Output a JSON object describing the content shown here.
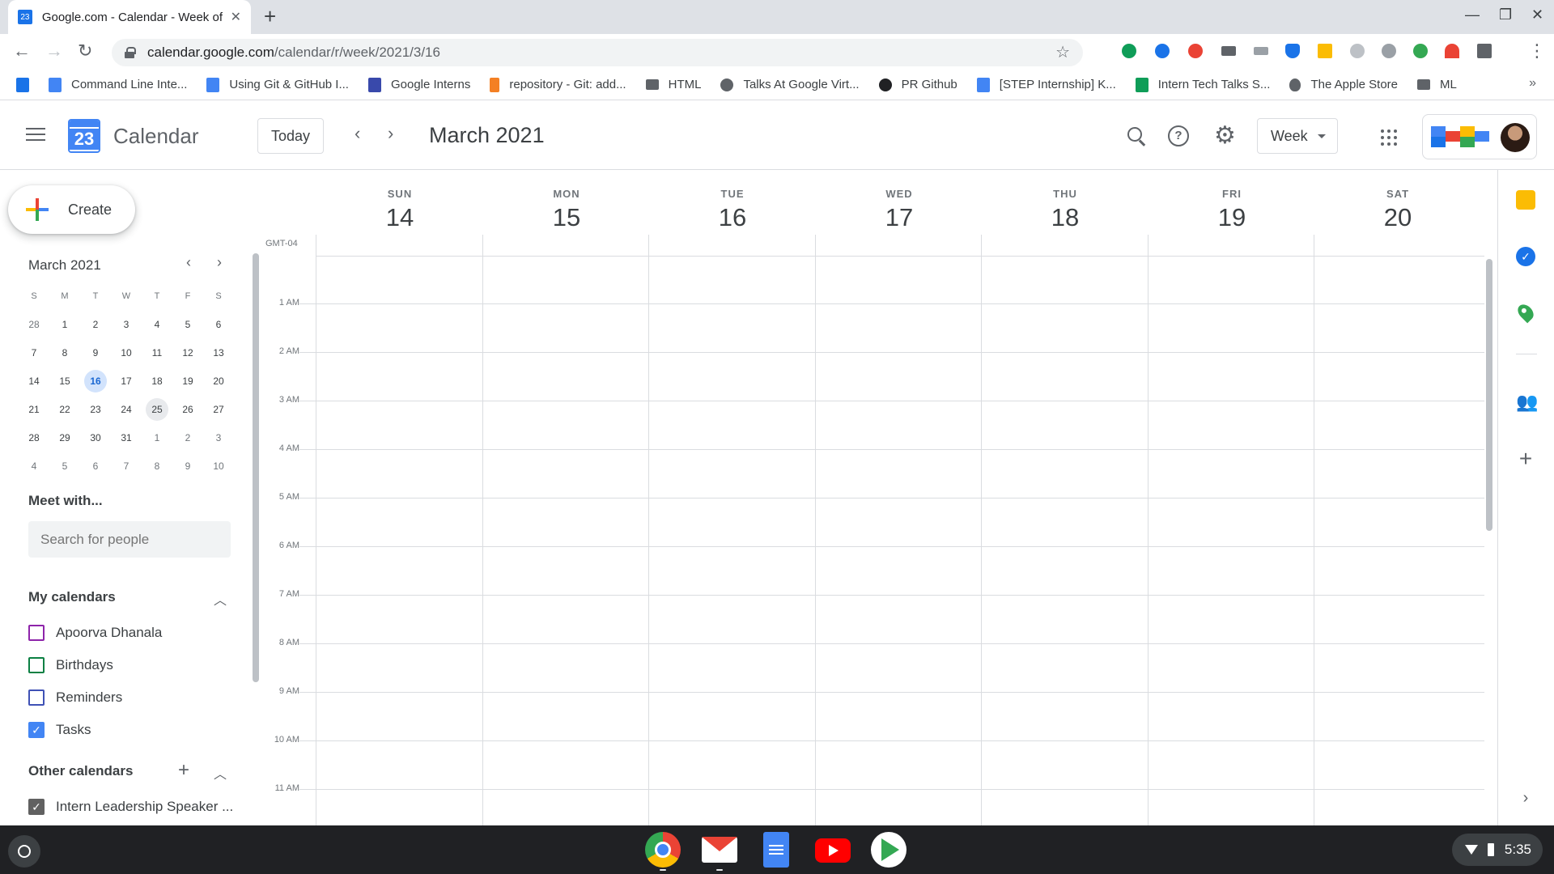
{
  "browser": {
    "tab_title": "Google.com - Calendar - Week of",
    "tab_favicon_text": "23",
    "url_host": "calendar.google.com",
    "url_path": "/calendar/r/week/2021/3/16",
    "bookmarks": [
      {
        "label": "Command Line Inte...",
        "icon": "docs-icon"
      },
      {
        "label": "Using Git & GitHub I...",
        "icon": "docs-icon"
      },
      {
        "label": "Google Interns",
        "icon": "site-icon"
      },
      {
        "label": "repository - Git: add...",
        "icon": "stackoverflow-icon"
      },
      {
        "label": "HTML",
        "icon": "folder-icon"
      },
      {
        "label": "Talks At Google Virt...",
        "icon": "globe-icon"
      },
      {
        "label": "PR Github",
        "icon": "github-icon"
      },
      {
        "label": "[STEP Internship] K...",
        "icon": "docs-icon"
      },
      {
        "label": "Intern Tech Talks S...",
        "icon": "sheets-icon"
      },
      {
        "label": "The Apple Store",
        "icon": "apple-icon"
      },
      {
        "label": "ML",
        "icon": "folder-icon"
      }
    ],
    "bookmarks_more": "»"
  },
  "header": {
    "logo_day": "23",
    "app_title": "Calendar",
    "today_label": "Today",
    "period": "March 2021",
    "view_label": "Week"
  },
  "sidebar": {
    "create_label": "Create",
    "mini_month": "March 2021",
    "weekday_initials": [
      "S",
      "M",
      "T",
      "W",
      "T",
      "F",
      "S"
    ],
    "mini_weeks": [
      [
        "28",
        "1",
        "2",
        "3",
        "4",
        "5",
        "6"
      ],
      [
        "7",
        "8",
        "9",
        "10",
        "11",
        "12",
        "13"
      ],
      [
        "14",
        "15",
        "16",
        "17",
        "18",
        "19",
        "20"
      ],
      [
        "21",
        "22",
        "23",
        "24",
        "25",
        "26",
        "27"
      ],
      [
        "28",
        "29",
        "30",
        "31",
        "1",
        "2",
        "3"
      ],
      [
        "4",
        "5",
        "6",
        "7",
        "8",
        "9",
        "10"
      ]
    ],
    "meet_with_title": "Meet with...",
    "people_search_placeholder": "Search for people",
    "my_calendars_title": "My calendars",
    "my_calendars": [
      {
        "label": "Apoorva Dhanala",
        "color": "#8e24aa",
        "checked": false
      },
      {
        "label": "Birthdays",
        "color": "#0b8043",
        "checked": false
      },
      {
        "label": "Reminders",
        "color": "#3f51b5",
        "checked": false
      },
      {
        "label": "Tasks",
        "color": "#4285f4",
        "checked": true
      }
    ],
    "other_calendars_title": "Other calendars",
    "other_calendars": [
      {
        "label": "Intern Leadership Speaker ...",
        "color": "#616161",
        "checked": true
      }
    ]
  },
  "week": {
    "timezone": "GMT-04",
    "days": [
      {
        "name": "SUN",
        "date": "14"
      },
      {
        "name": "MON",
        "date": "15"
      },
      {
        "name": "TUE",
        "date": "16"
      },
      {
        "name": "WED",
        "date": "17"
      },
      {
        "name": "THU",
        "date": "18"
      },
      {
        "name": "FRI",
        "date": "19"
      },
      {
        "name": "SAT",
        "date": "20"
      }
    ],
    "hours": [
      "1 AM",
      "2 AM",
      "3 AM",
      "4 AM",
      "5 AM",
      "6 AM",
      "7 AM",
      "8 AM",
      "9 AM",
      "10 AM",
      "11 AM"
    ]
  },
  "system": {
    "time": "5:35"
  },
  "colors": {
    "accent": "#1a73e8",
    "today_highlight": "#d2e3fc",
    "grid_line": "#dadce0"
  }
}
